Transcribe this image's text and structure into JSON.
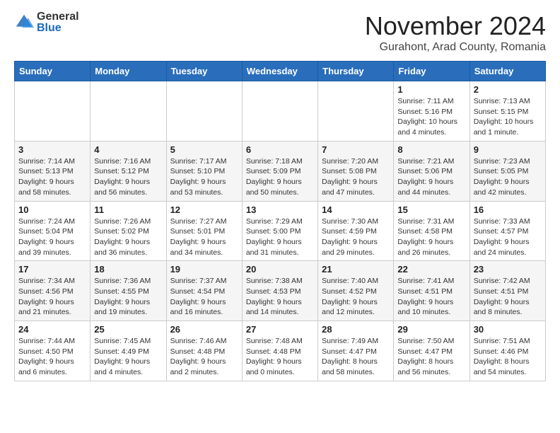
{
  "header": {
    "logo_general": "General",
    "logo_blue": "Blue",
    "month_title": "November 2024",
    "location": "Gurahont, Arad County, Romania"
  },
  "weekdays": [
    "Sunday",
    "Monday",
    "Tuesday",
    "Wednesday",
    "Thursday",
    "Friday",
    "Saturday"
  ],
  "weeks": [
    [
      {
        "day": "",
        "info": ""
      },
      {
        "day": "",
        "info": ""
      },
      {
        "day": "",
        "info": ""
      },
      {
        "day": "",
        "info": ""
      },
      {
        "day": "",
        "info": ""
      },
      {
        "day": "1",
        "info": "Sunrise: 7:11 AM\nSunset: 5:16 PM\nDaylight: 10 hours and 4 minutes."
      },
      {
        "day": "2",
        "info": "Sunrise: 7:13 AM\nSunset: 5:15 PM\nDaylight: 10 hours and 1 minute."
      }
    ],
    [
      {
        "day": "3",
        "info": "Sunrise: 7:14 AM\nSunset: 5:13 PM\nDaylight: 9 hours and 58 minutes."
      },
      {
        "day": "4",
        "info": "Sunrise: 7:16 AM\nSunset: 5:12 PM\nDaylight: 9 hours and 56 minutes."
      },
      {
        "day": "5",
        "info": "Sunrise: 7:17 AM\nSunset: 5:10 PM\nDaylight: 9 hours and 53 minutes."
      },
      {
        "day": "6",
        "info": "Sunrise: 7:18 AM\nSunset: 5:09 PM\nDaylight: 9 hours and 50 minutes."
      },
      {
        "day": "7",
        "info": "Sunrise: 7:20 AM\nSunset: 5:08 PM\nDaylight: 9 hours and 47 minutes."
      },
      {
        "day": "8",
        "info": "Sunrise: 7:21 AM\nSunset: 5:06 PM\nDaylight: 9 hours and 44 minutes."
      },
      {
        "day": "9",
        "info": "Sunrise: 7:23 AM\nSunset: 5:05 PM\nDaylight: 9 hours and 42 minutes."
      }
    ],
    [
      {
        "day": "10",
        "info": "Sunrise: 7:24 AM\nSunset: 5:04 PM\nDaylight: 9 hours and 39 minutes."
      },
      {
        "day": "11",
        "info": "Sunrise: 7:26 AM\nSunset: 5:02 PM\nDaylight: 9 hours and 36 minutes."
      },
      {
        "day": "12",
        "info": "Sunrise: 7:27 AM\nSunset: 5:01 PM\nDaylight: 9 hours and 34 minutes."
      },
      {
        "day": "13",
        "info": "Sunrise: 7:29 AM\nSunset: 5:00 PM\nDaylight: 9 hours and 31 minutes."
      },
      {
        "day": "14",
        "info": "Sunrise: 7:30 AM\nSunset: 4:59 PM\nDaylight: 9 hours and 29 minutes."
      },
      {
        "day": "15",
        "info": "Sunrise: 7:31 AM\nSunset: 4:58 PM\nDaylight: 9 hours and 26 minutes."
      },
      {
        "day": "16",
        "info": "Sunrise: 7:33 AM\nSunset: 4:57 PM\nDaylight: 9 hours and 24 minutes."
      }
    ],
    [
      {
        "day": "17",
        "info": "Sunrise: 7:34 AM\nSunset: 4:56 PM\nDaylight: 9 hours and 21 minutes."
      },
      {
        "day": "18",
        "info": "Sunrise: 7:36 AM\nSunset: 4:55 PM\nDaylight: 9 hours and 19 minutes."
      },
      {
        "day": "19",
        "info": "Sunrise: 7:37 AM\nSunset: 4:54 PM\nDaylight: 9 hours and 16 minutes."
      },
      {
        "day": "20",
        "info": "Sunrise: 7:38 AM\nSunset: 4:53 PM\nDaylight: 9 hours and 14 minutes."
      },
      {
        "day": "21",
        "info": "Sunrise: 7:40 AM\nSunset: 4:52 PM\nDaylight: 9 hours and 12 minutes."
      },
      {
        "day": "22",
        "info": "Sunrise: 7:41 AM\nSunset: 4:51 PM\nDaylight: 9 hours and 10 minutes."
      },
      {
        "day": "23",
        "info": "Sunrise: 7:42 AM\nSunset: 4:51 PM\nDaylight: 9 hours and 8 minutes."
      }
    ],
    [
      {
        "day": "24",
        "info": "Sunrise: 7:44 AM\nSunset: 4:50 PM\nDaylight: 9 hours and 6 minutes."
      },
      {
        "day": "25",
        "info": "Sunrise: 7:45 AM\nSunset: 4:49 PM\nDaylight: 9 hours and 4 minutes."
      },
      {
        "day": "26",
        "info": "Sunrise: 7:46 AM\nSunset: 4:48 PM\nDaylight: 9 hours and 2 minutes."
      },
      {
        "day": "27",
        "info": "Sunrise: 7:48 AM\nSunset: 4:48 PM\nDaylight: 9 hours and 0 minutes."
      },
      {
        "day": "28",
        "info": "Sunrise: 7:49 AM\nSunset: 4:47 PM\nDaylight: 8 hours and 58 minutes."
      },
      {
        "day": "29",
        "info": "Sunrise: 7:50 AM\nSunset: 4:47 PM\nDaylight: 8 hours and 56 minutes."
      },
      {
        "day": "30",
        "info": "Sunrise: 7:51 AM\nSunset: 4:46 PM\nDaylight: 8 hours and 54 minutes."
      }
    ]
  ]
}
